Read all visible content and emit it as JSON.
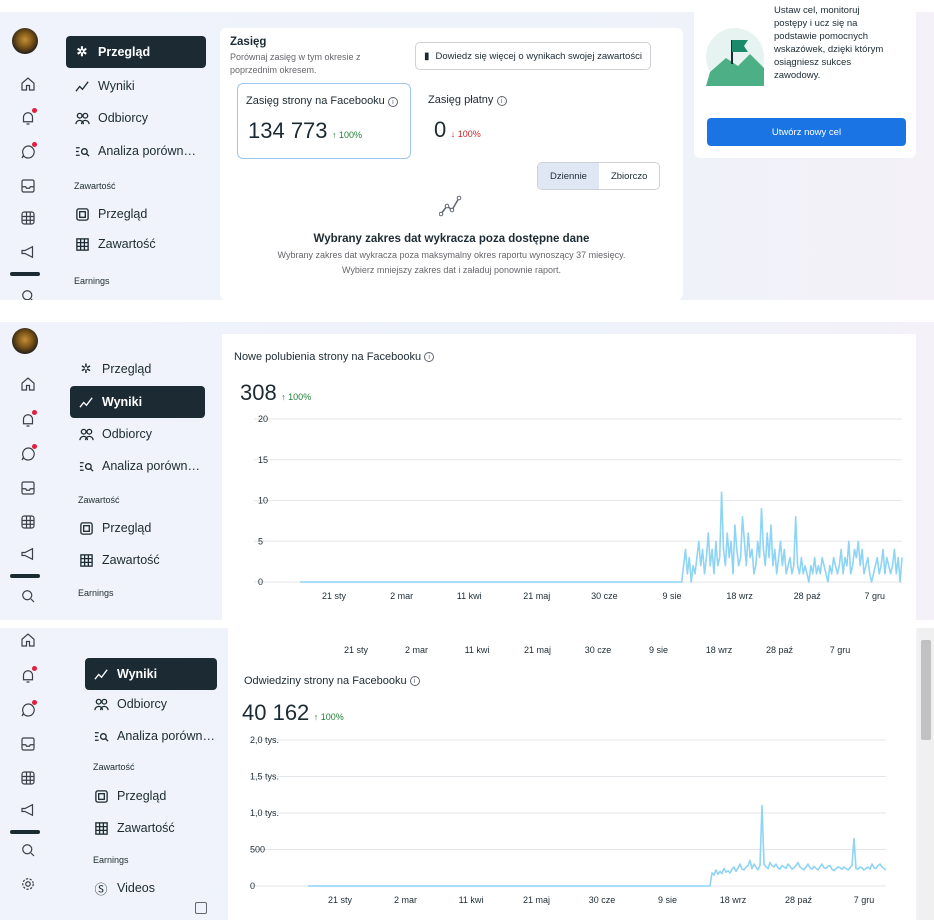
{
  "rail_icons": [
    "home-icon",
    "bell-icon",
    "chat-icon",
    "inbox-icon",
    "grid-icon",
    "megaphone-icon",
    "search-icon",
    "gear-icon"
  ],
  "nav": {
    "overview": "Przegląd",
    "results": "Wyniki",
    "audience": "Odbiorcy",
    "benchmark": "Analiza porówn…",
    "content_header": "Zawartość",
    "content_overview": "Przegląd",
    "content": "Zawartość",
    "earnings_header": "Earnings",
    "videos": "Videos"
  },
  "reach": {
    "title": "Zasięg",
    "subtitle_1": "Porównaj zasięg w tym okresie z",
    "subtitle_2": "poprzednim okresem.",
    "learn_button": "Dowiedz się więcej o wynikach swojej zawartości",
    "fb_label": "Zasięg strony na Facebooku",
    "fb_value": "134 773",
    "fb_change": "↑ 100%",
    "paid_label": "Zasięg płatny",
    "paid_value": "0",
    "paid_change": "↓ 100%",
    "toggle_daily": "Dziennie",
    "toggle_total": "Zbiorczo",
    "error_title": "Wybrany zakres dat wykracza poza dostępne dane",
    "error_line1": "Wybrany zakres dat wykracza poza maksymalny okres raportu wynoszący 37 miesięcy.",
    "error_line2": "Wybierz mniejszy zakres dat i załaduj ponownie raport."
  },
  "goal": {
    "text_1": "Ustaw cel, monitoruj",
    "text_2": "postępy i ucz się na",
    "text_3": "podstawie pomocnych",
    "text_4": "wskazówek, dzięki którym",
    "text_5": "osiągniesz sukces",
    "text_6": "zawodowy.",
    "button": "Utwórz nowy cel"
  },
  "colors": {
    "line": "#8ed4f5",
    "nav_active": "#1c2b33",
    "primary_button": "#1b74e4"
  },
  "chart_data": [
    {
      "type": "line",
      "title": "Nowe polubienia strony na Facebooku",
      "headline": "308",
      "change": "↑ 100%",
      "x_ticks": [
        "21 sty",
        "2 mar",
        "11 kwi",
        "21 maj",
        "30 cze",
        "9 sie",
        "18 wrz",
        "28 paź",
        "7 gru"
      ],
      "y_ticks": [
        "0",
        "5",
        "10",
        "15",
        "20"
      ],
      "ylim": [
        0,
        20
      ],
      "values": [
        0,
        0,
        0,
        0,
        0,
        0,
        0,
        0,
        0,
        0,
        0,
        0,
        0,
        0,
        0,
        0,
        0,
        0,
        0,
        0,
        0,
        0,
        0,
        0,
        0,
        0,
        0,
        0,
        0,
        0,
        0,
        0,
        0,
        0,
        0,
        0,
        0,
        0,
        0,
        0,
        0,
        0,
        0,
        0,
        0,
        0,
        0,
        0,
        0,
        0,
        0,
        0,
        0,
        0,
        0,
        0,
        0,
        0,
        0,
        0,
        0,
        0,
        0,
        0,
        0,
        0,
        0,
        0,
        0,
        0,
        0,
        0,
        0,
        0,
        0,
        0,
        0,
        0,
        0,
        0,
        0,
        0,
        0,
        0,
        0,
        0,
        0,
        0,
        0,
        0,
        0,
        0,
        0,
        0,
        0,
        0,
        0,
        0,
        0,
        0,
        0,
        0,
        0,
        0,
        0,
        0,
        0,
        0,
        0,
        0,
        0,
        0,
        0,
        0,
        0,
        0,
        0,
        0,
        0,
        0,
        0,
        0,
        0,
        0,
        0,
        0,
        0,
        0,
        0,
        0,
        0,
        0,
        0,
        0,
        0,
        0,
        0,
        0,
        0,
        0,
        0,
        0,
        0,
        0,
        0,
        0,
        0,
        0,
        0,
        0,
        0,
        0,
        0,
        0,
        0,
        0,
        0,
        0,
        0,
        0,
        0,
        0,
        0,
        0,
        0,
        0,
        0,
        0,
        0,
        0,
        0,
        0,
        0,
        0,
        0,
        0,
        0,
        0,
        0,
        0,
        0,
        0,
        0,
        0,
        0,
        0,
        0,
        0,
        0,
        0,
        0,
        0,
        0,
        0,
        0,
        0,
        0,
        0,
        0,
        0,
        0,
        0,
        2,
        4,
        1,
        3,
        0,
        2,
        1,
        3,
        5,
        2,
        4,
        1,
        3,
        6,
        2,
        4,
        1,
        5,
        2,
        3,
        11,
        4,
        2,
        6,
        3,
        5,
        1,
        7,
        4,
        2,
        3,
        8,
        5,
        2,
        6,
        3,
        4,
        1,
        2,
        5,
        3,
        9,
        4,
        2,
        6,
        3,
        7,
        2,
        4,
        1,
        3,
        5,
        2,
        4,
        1,
        2,
        3,
        1,
        2,
        8,
        2,
        1,
        3,
        1,
        2,
        1,
        0,
        2,
        1,
        3,
        1,
        2,
        1,
        3,
        2,
        1,
        0,
        2,
        1,
        3,
        2,
        1,
        2,
        4,
        1,
        3,
        2,
        5,
        1,
        2,
        4,
        3,
        5,
        2,
        4,
        1,
        2,
        3,
        1,
        0,
        1,
        2,
        3,
        1,
        2,
        4,
        1,
        3,
        2,
        1,
        2,
        4,
        1,
        3,
        0,
        3
      ]
    },
    {
      "type": "line",
      "title": "Odwiedziny strony na Facebooku",
      "headline": "40 162",
      "change": "↑ 100%",
      "x_ticks": [
        "21 sty",
        "2 mar",
        "11 kwi",
        "21 maj",
        "30 cze",
        "9 sie",
        "18 wrz",
        "28 paź",
        "7 gru"
      ],
      "y_ticks": [
        "0",
        "500",
        "1,0 tys.",
        "1,5 tys.",
        "2,0 tys."
      ],
      "ylim": [
        0,
        2000
      ],
      "values": [
        0,
        0,
        0,
        0,
        0,
        0,
        0,
        0,
        0,
        0,
        0,
        0,
        0,
        0,
        0,
        0,
        0,
        0,
        0,
        0,
        0,
        0,
        0,
        0,
        0,
        0,
        0,
        0,
        0,
        0,
        0,
        0,
        0,
        0,
        0,
        0,
        0,
        0,
        0,
        0,
        0,
        0,
        0,
        0,
        0,
        0,
        0,
        0,
        0,
        0,
        0,
        0,
        0,
        0,
        0,
        0,
        0,
        0,
        0,
        0,
        0,
        0,
        0,
        0,
        0,
        0,
        0,
        0,
        0,
        0,
        0,
        0,
        0,
        0,
        0,
        0,
        0,
        0,
        0,
        0,
        0,
        0,
        0,
        0,
        0,
        0,
        0,
        0,
        0,
        0,
        0,
        0,
        0,
        0,
        0,
        0,
        0,
        0,
        0,
        0,
        0,
        0,
        0,
        0,
        0,
        0,
        0,
        0,
        0,
        0,
        0,
        0,
        0,
        0,
        0,
        0,
        0,
        0,
        0,
        0,
        0,
        0,
        0,
        0,
        0,
        0,
        0,
        0,
        0,
        0,
        0,
        0,
        0,
        0,
        0,
        0,
        0,
        0,
        0,
        0,
        0,
        0,
        0,
        0,
        0,
        0,
        0,
        0,
        0,
        0,
        0,
        0,
        0,
        0,
        0,
        0,
        0,
        0,
        0,
        0,
        0,
        0,
        0,
        0,
        0,
        0,
        0,
        0,
        0,
        0,
        0,
        0,
        0,
        0,
        0,
        0,
        0,
        0,
        0,
        0,
        0,
        0,
        0,
        0,
        0,
        0,
        0,
        0,
        0,
        0,
        0,
        0,
        0,
        0,
        0,
        0,
        0,
        0,
        0,
        0,
        0,
        0,
        180,
        150,
        220,
        160,
        200,
        170,
        240,
        190,
        210,
        180,
        230,
        260,
        200,
        250,
        300,
        230,
        220,
        260,
        280,
        350,
        240,
        300,
        260,
        220,
        280,
        1100,
        300,
        260,
        240,
        320,
        280,
        260,
        300,
        250,
        230,
        280,
        260,
        240,
        300,
        270,
        230,
        250,
        280,
        320,
        260,
        240,
        220,
        260,
        300,
        250,
        230,
        270,
        240,
        220,
        260,
        300,
        250,
        240,
        270,
        280,
        230,
        210,
        240,
        260,
        250,
        230,
        260,
        240,
        220,
        250,
        280,
        650,
        240,
        230,
        260,
        250,
        220,
        240,
        260,
        230,
        300,
        250,
        240,
        280,
        300,
        260,
        240,
        220
      ]
    }
  ]
}
